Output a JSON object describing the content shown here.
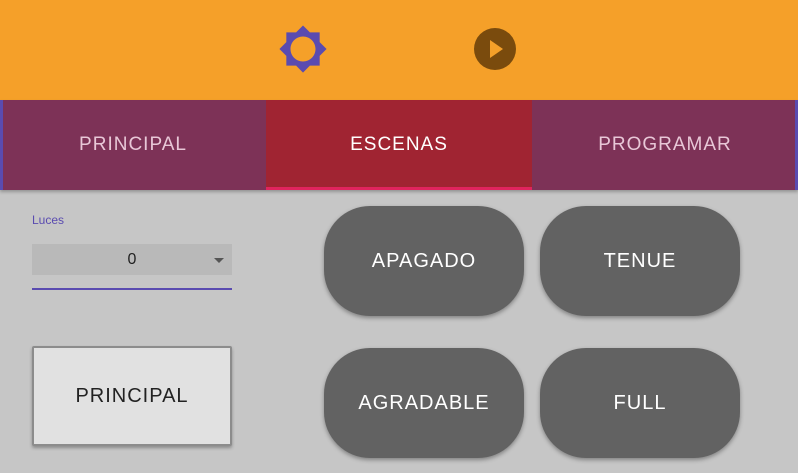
{
  "header": {
    "brightness_icon": "brightness-icon",
    "play_icon": "play-circle-icon",
    "colors": {
      "bar": "#f5a029",
      "brightness_icon": "#5a4bb0",
      "play_icon": "#7a4b0d"
    }
  },
  "tabs": [
    {
      "label": "PRINCIPAL",
      "active": false
    },
    {
      "label": "ESCENAS",
      "active": true
    },
    {
      "label": "PROGRAMAR",
      "active": false
    }
  ],
  "lights": {
    "label": "Luces",
    "value": "0"
  },
  "home_button": {
    "label": "PRINCIPAL"
  },
  "scenes": [
    {
      "label": "APAGADO"
    },
    {
      "label": "TENUE"
    },
    {
      "label": "AGRADABLE"
    },
    {
      "label": "FULL"
    }
  ],
  "colors": {
    "background": "#c6c6c6",
    "tab_bar": "#7d3257",
    "tab_active": "#a02432",
    "tab_indicator": "#e0245e",
    "accent": "#5a4bb0",
    "scene_button": "#626262"
  }
}
